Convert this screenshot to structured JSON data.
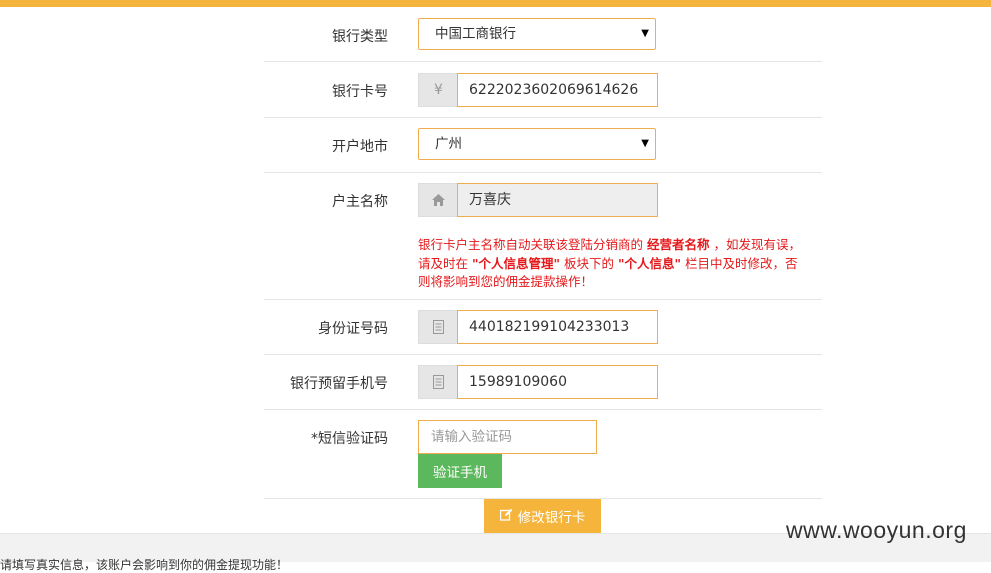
{
  "form": {
    "bank_type": {
      "label": "银行类型",
      "value": "中国工商银行"
    },
    "card_no": {
      "label": "银行卡号",
      "prefix": "¥",
      "value": "6222023602069614626"
    },
    "city": {
      "label": "开户地市",
      "value": "广州"
    },
    "holder": {
      "label": "户主名称",
      "value": "万喜庆"
    },
    "note": {
      "p1": "银行卡户主名称自动关联该登陆分销商的 ",
      "b1": "经营者名称",
      "p2": " ，如发现有误，请及时在 ",
      "b2": "\"个人信息管理\"",
      "p3": " 板块下的 ",
      "b3": "\"个人信息\"",
      "p4": " 栏目中及时修改，否则将影响到您的佣金提款操作！"
    },
    "id_no": {
      "label": "身份证号码",
      "value": "440182199104233013"
    },
    "phone": {
      "label": "银行预留手机号",
      "value": "15989109060"
    },
    "sms": {
      "label": "*短信验证码",
      "placeholder": "请输入验证码",
      "button": "验证手机"
    },
    "submit": "修改银行卡"
  },
  "footer_text": "请填写真实信息，该账户会影响到你的佣金提现功能！",
  "watermark": "www.wooyun.org",
  "colors": {
    "accent": "#f5b43c",
    "input_border": "#f0ad4e",
    "success": "#5cb85c",
    "warning_text": "#e5191b"
  }
}
